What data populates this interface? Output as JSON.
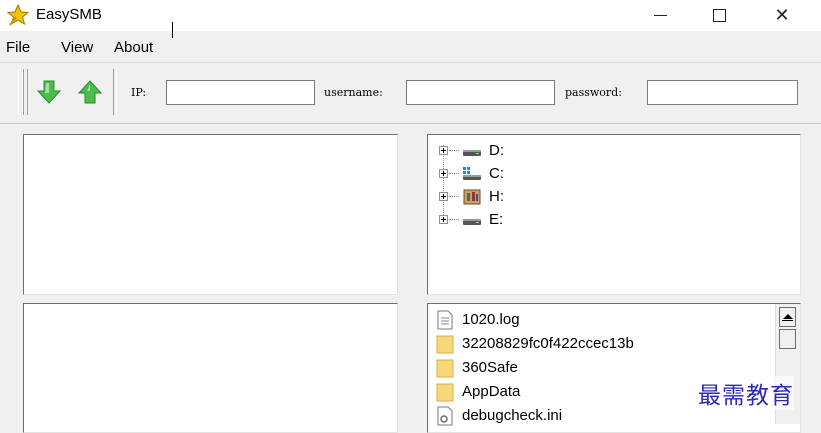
{
  "window": {
    "title": "EasySMB",
    "app_icon": "star-icon",
    "controls": {
      "minimize": "minimize-icon",
      "maximize": "maximize-icon",
      "close": "close-icon"
    },
    "close_glyph": "✕"
  },
  "menu": {
    "items": [
      {
        "label": "File"
      },
      {
        "label": "View"
      },
      {
        "label": "About"
      }
    ]
  },
  "toolbar": {
    "download_icon": "download-arrow-icon",
    "upload_icon": "upload-arrow-icon",
    "ip_label": "IP:",
    "ip_value": "",
    "username_label": "username:",
    "username_value": "",
    "password_label": "password:",
    "password_value": ""
  },
  "local_tree": {
    "drives": [
      {
        "label": "D:",
        "icon": "hard-drive-icon"
      },
      {
        "label": "C:",
        "icon": "system-drive-icon"
      },
      {
        "label": "H:",
        "icon": "network-drive-icon"
      },
      {
        "label": "E:",
        "icon": "hard-drive-icon"
      }
    ]
  },
  "local_files": {
    "items": [
      {
        "name": "1020.log",
        "type": "file"
      },
      {
        "name": "32208829fc0f422ccec13b",
        "type": "folder"
      },
      {
        "name": "360Safe",
        "type": "folder"
      },
      {
        "name": "AppData",
        "type": "folder"
      },
      {
        "name": "debugcheck.ini",
        "type": "ini-file"
      }
    ]
  },
  "watermark": {
    "text": "最需教育"
  },
  "colors": {
    "folder": "#f7d878",
    "arrow_green": "#3fae3f",
    "watermark": "#2a2ab0"
  }
}
